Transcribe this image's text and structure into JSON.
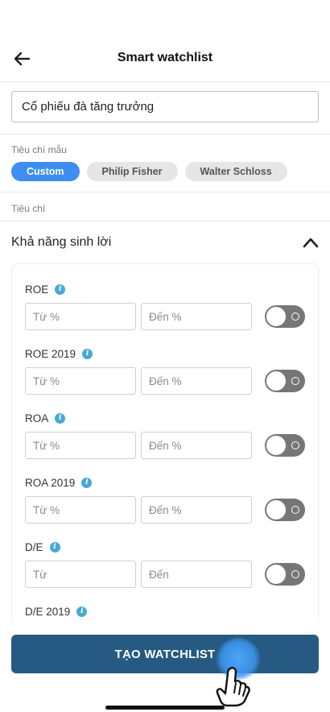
{
  "header": {
    "title": "Smart watchlist"
  },
  "watchlist_name": {
    "value": "Cổ phiếu đà tăng trưởng"
  },
  "templates": {
    "label": "Tiêu chí mẫu",
    "chips": [
      "Custom",
      "Philip Fisher",
      "Walter Schloss"
    ],
    "selected": "Custom"
  },
  "criteria": {
    "label": "Tiêu chí",
    "group": {
      "title": "Khả năng sinh lời",
      "expanded": true,
      "items": [
        {
          "label": "ROE",
          "from_placeholder": "Từ %",
          "to_placeholder": "Đến %",
          "enabled": false
        },
        {
          "label": "ROE 2019",
          "from_placeholder": "Từ %",
          "to_placeholder": "Đến %",
          "enabled": false
        },
        {
          "label": "ROA",
          "from_placeholder": "Từ %",
          "to_placeholder": "Đến %",
          "enabled": false
        },
        {
          "label": "ROA 2019",
          "from_placeholder": "Từ %",
          "to_placeholder": "Đến %",
          "enabled": false
        },
        {
          "label": "D/E",
          "from_placeholder": "Từ",
          "to_placeholder": "Đến",
          "enabled": false
        },
        {
          "label": "D/E 2019"
        }
      ]
    }
  },
  "action": {
    "create_label": "TẠO WATCHLIST"
  },
  "colors": {
    "accent": "#3d8ef0",
    "primary_button": "#265a82",
    "toggle_off": "#767676",
    "info": "#4aa8d6"
  },
  "icons": {
    "back": "arrow-left-icon",
    "collapse": "chevron-up-icon",
    "info": "info-icon",
    "touch": "hand-pointer-icon"
  }
}
